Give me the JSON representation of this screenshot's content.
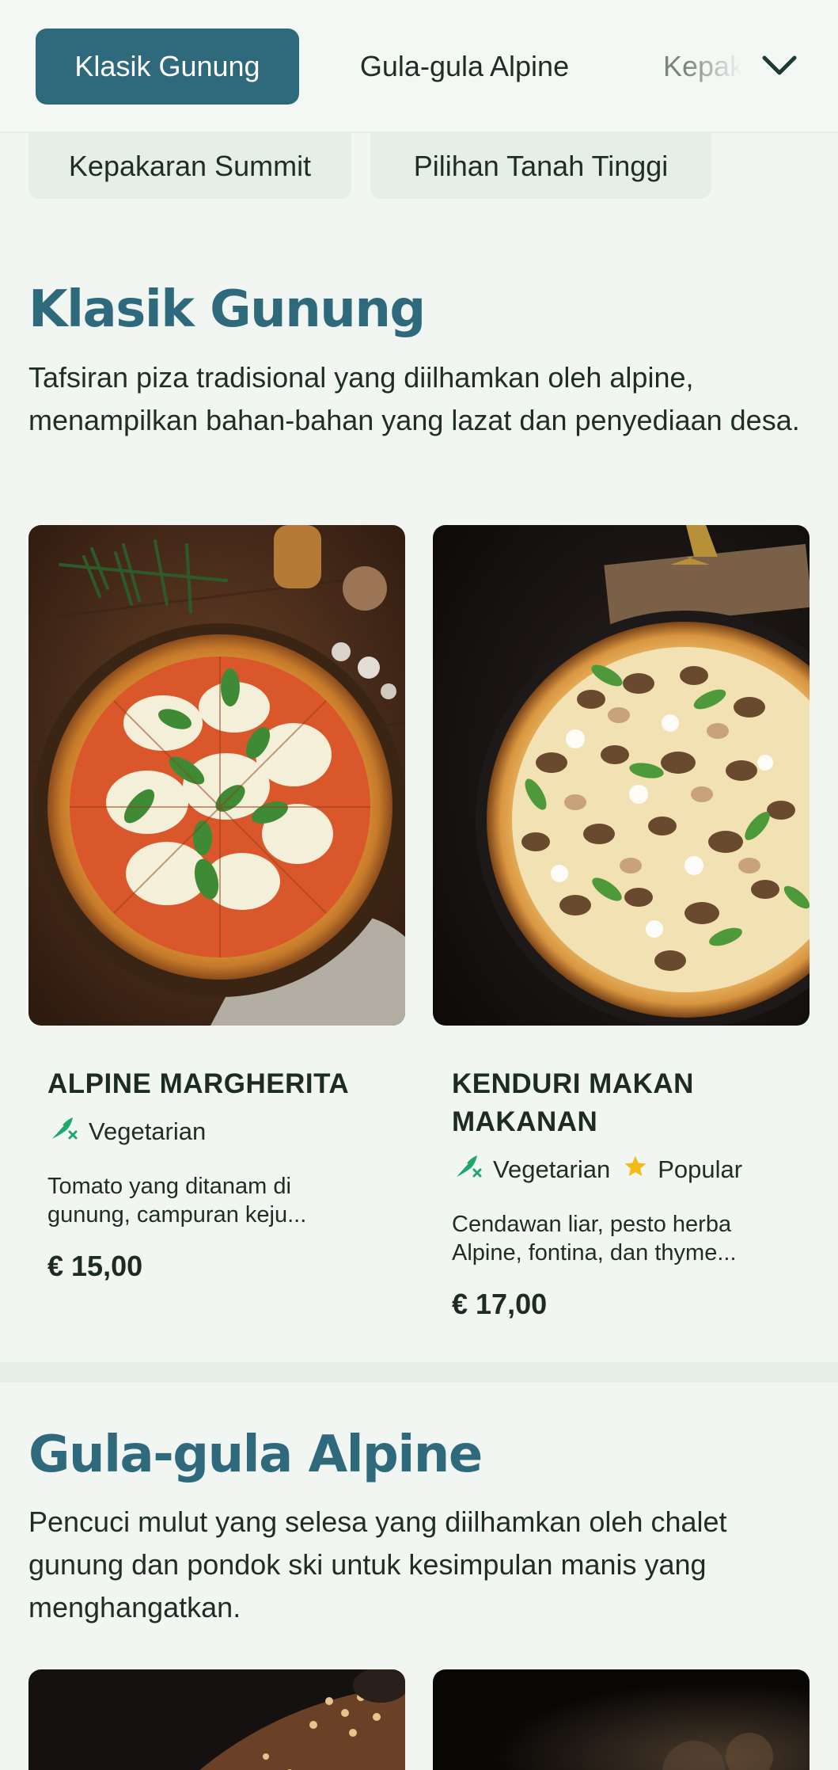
{
  "nav": {
    "tabs": [
      {
        "label": "Klasik Gunung",
        "active": true
      },
      {
        "label": "Gula-gula Alpine",
        "active": false
      },
      {
        "label": "Kepakaran Summit",
        "active": false
      }
    ],
    "more_icon": "chevron-down-icon",
    "chips": [
      "Kepakaran Summit",
      "Pilihan Tanah Tinggi"
    ]
  },
  "sections": [
    {
      "title": "Klasik Gunung",
      "description": "Tafsiran piza tradisional yang diilhamkan oleh alpine, menampilkan bahan-bahan yang lazat dan penyediaan desa.",
      "items": [
        {
          "name": "ALPINE MARGHERITA",
          "tags": [
            {
              "icon": "vegetarian-icon",
              "label": "Vegetarian"
            }
          ],
          "description": "Tomato yang ditanam di gunung, campuran keju...",
          "price": "€ 15,00"
        },
        {
          "name": "KENDURI MAKAN MAKANAN",
          "tags": [
            {
              "icon": "vegetarian-icon",
              "label": "Vegetarian"
            },
            {
              "icon": "star-icon",
              "label": "Popular"
            }
          ],
          "description": "Cendawan liar, pesto herba Alpine, fontina, dan thyme...",
          "price": "€ 17,00"
        }
      ]
    },
    {
      "title": "Gula-gula Alpine",
      "description": "Pencuci mulut yang selesa yang diilhamkan oleh chalet gunung dan pondok ski untuk kesimpulan manis yang menghangatkan."
    }
  ],
  "colors": {
    "accent": "#2f6a7c",
    "background": "#f1f6f2",
    "vegetarian": "#1ea86b",
    "star": "#f5b918"
  }
}
